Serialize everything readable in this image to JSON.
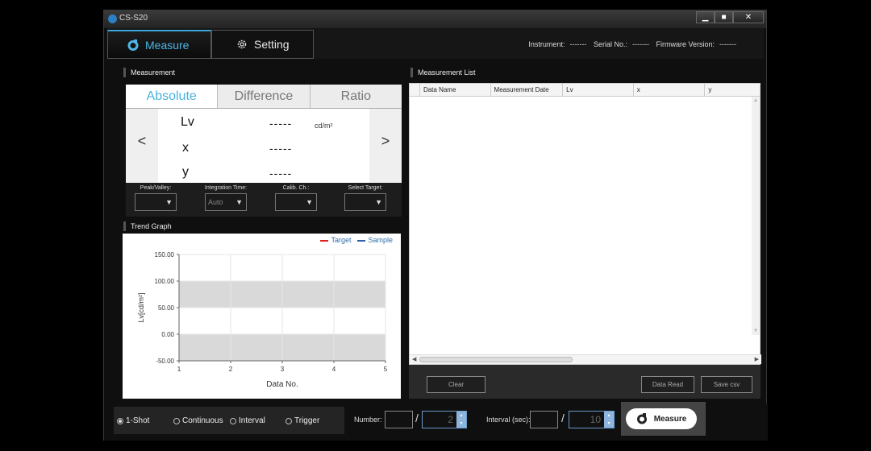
{
  "window": {
    "title": "CS-S20",
    "min": "▁",
    "max": "■",
    "close": "✕"
  },
  "tabs": {
    "measure": "Measure",
    "setting": "Setting"
  },
  "instrument": {
    "instrument_label": "Instrument:",
    "instrument_value": "-------",
    "serial_label": "Serial No.:",
    "serial_value": "-------",
    "firmware_label": "Firmware Version:",
    "firmware_value": "-------"
  },
  "measurement": {
    "section": "Measurement",
    "modes": [
      "Absolute",
      "Difference",
      "Ratio"
    ],
    "prev": "<",
    "next": ">",
    "rows": [
      {
        "name": "Lv",
        "value": "-----",
        "unit": "cd/m²"
      },
      {
        "name": "x",
        "value": "-----"
      },
      {
        "name": "y",
        "value": "-----"
      }
    ],
    "combos": [
      {
        "label": "Peak/Valley:",
        "value": ""
      },
      {
        "label": "Integration Time:",
        "value": "Auto"
      },
      {
        "label": "Calib. Ch.:",
        "value": ""
      },
      {
        "label": "Select Target:",
        "value": ""
      }
    ]
  },
  "trend": {
    "section": "Trend Graph",
    "legend_target": "Target",
    "legend_sample": "Sample",
    "target_color": "#e0201b",
    "sample_color": "#2f5fa8"
  },
  "list": {
    "section": "Measurement List",
    "columns": [
      "Data Name",
      "Measurement Date",
      "Lv",
      "x",
      "y"
    ],
    "clear": "Clear",
    "data_read": "Data Read",
    "save_csv": "Save csv"
  },
  "bottom": {
    "modes": [
      "1-Shot",
      "Continuous",
      "Interval",
      "Trigger"
    ],
    "selected_mode": "1-Shot",
    "number_label": "Number:",
    "number_total": "2",
    "interval_label": "Interval (sec):",
    "interval_value": "10",
    "slash": "/",
    "measure": "Measure"
  },
  "chart_data": {
    "type": "line",
    "title": "",
    "xlabel": "Data No.",
    "ylabel": "Lv[cd/m²]",
    "x_ticks": [
      1,
      2,
      3,
      4,
      5
    ],
    "y_ticks": [
      "150.00",
      "100.00",
      "50.00",
      "0.00",
      "-50.00"
    ],
    "xlim": [
      1,
      5
    ],
    "ylim": [
      -50,
      150
    ],
    "bands": [
      [
        50,
        100
      ],
      [
        -50,
        0
      ]
    ],
    "grid": true,
    "legend": "top-right",
    "series": [
      {
        "name": "Target",
        "values": []
      },
      {
        "name": "Sample",
        "values": []
      }
    ]
  }
}
